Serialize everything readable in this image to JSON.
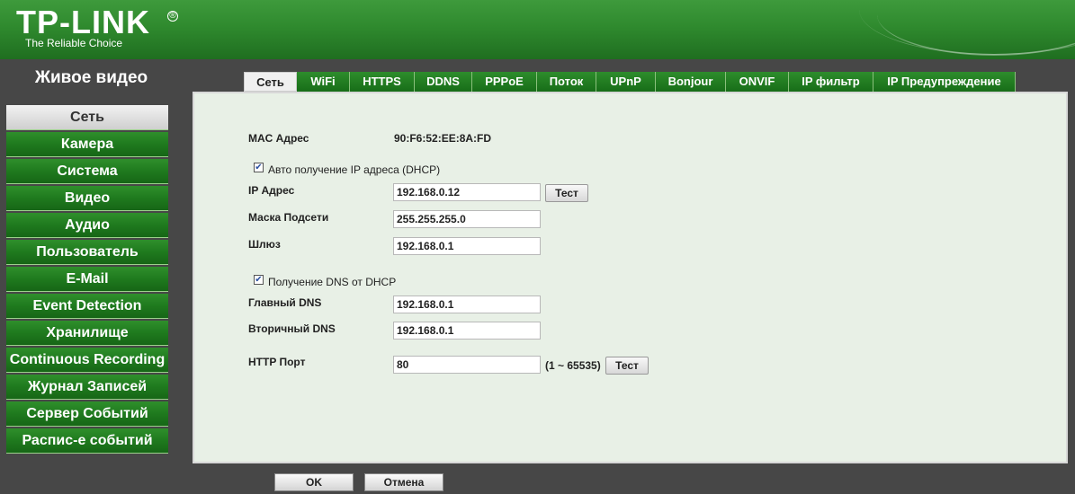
{
  "brand": {
    "logo": "TP-LINK",
    "tagline": "The Reliable Choice"
  },
  "sidebar": {
    "title": "Живое видео",
    "items": [
      {
        "label": "Сеть",
        "active": true
      },
      {
        "label": "Камера"
      },
      {
        "label": "Система"
      },
      {
        "label": "Видео"
      },
      {
        "label": "Аудио"
      },
      {
        "label": "Пользователь"
      },
      {
        "label": "E-Mail"
      },
      {
        "label": "Event Detection"
      },
      {
        "label": "Хранилище"
      },
      {
        "label": "Continuous Recording"
      },
      {
        "label": "Журнал Записей"
      },
      {
        "label": "Сервер Событий"
      },
      {
        "label": "Распис-е событий"
      }
    ]
  },
  "tabs": [
    {
      "label": "Сеть",
      "active": true
    },
    {
      "label": "WiFi"
    },
    {
      "label": "HTTPS"
    },
    {
      "label": "DDNS"
    },
    {
      "label": "PPPoE"
    },
    {
      "label": "Поток"
    },
    {
      "label": "UPnP"
    },
    {
      "label": "Bonjour"
    },
    {
      "label": "ONVIF"
    },
    {
      "label": "IP фильтр"
    },
    {
      "label": "IP Предупреждение"
    }
  ],
  "network": {
    "mac_label": "MAC Адрес",
    "mac_value": "90:F6:52:EE:8A:FD",
    "dhcp_label": "Авто получение IP адреса (DHCP)",
    "dhcp_checked": true,
    "ip_label": "IP Адрес",
    "ip_value": "192.168.0.12",
    "test_label": "Тест",
    "mask_label": "Маска Подсети",
    "mask_value": "255.255.255.0",
    "gateway_label": "Шлюз",
    "gateway_value": "192.168.0.1",
    "dns_dhcp_label": "Получение DNS от DHCP",
    "dns_dhcp_checked": true,
    "primary_dns_label": "Главный DNS",
    "primary_dns_value": "192.168.0.1",
    "secondary_dns_label": "Вторичный DNS",
    "secondary_dns_value": "192.168.0.1",
    "http_port_label": "HTTP Порт",
    "http_port_value": "80",
    "http_port_range": "(1 ~ 65535)",
    "http_test_label": "Тест"
  },
  "footer": {
    "ok_label": "OK",
    "cancel_label": "Отмена"
  },
  "colors": {
    "brand_green": "#2f8a2e",
    "panel_bg": "#e8f0e6",
    "frame_bg": "#474747"
  }
}
